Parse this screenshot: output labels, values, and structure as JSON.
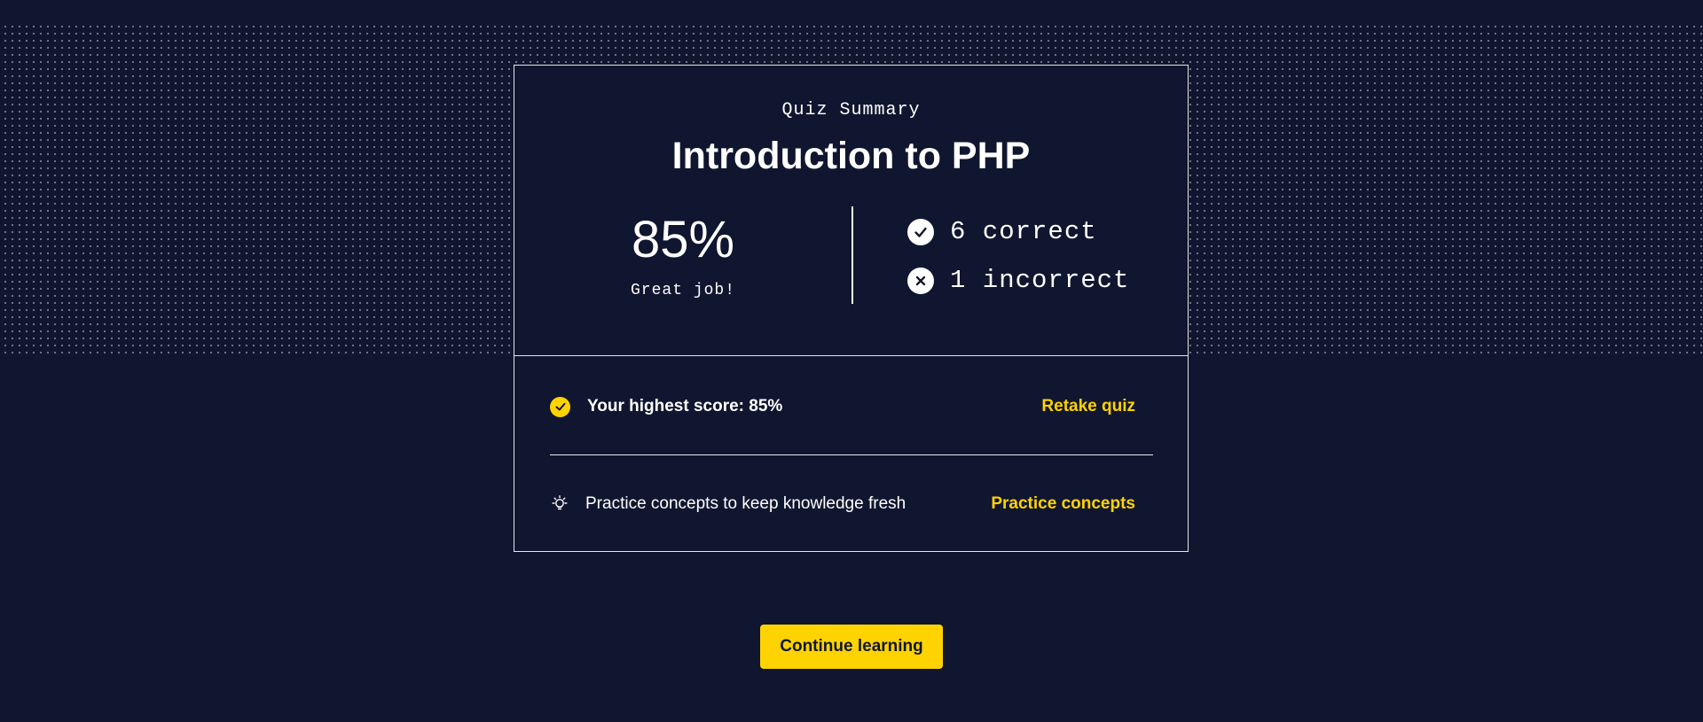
{
  "summary": {
    "eyebrow": "Quiz Summary",
    "title": "Introduction to PHP",
    "score": "85%",
    "score_message": "Great job!",
    "correct_label": "6 correct",
    "incorrect_label": "1 incorrect",
    "icons": {
      "correct": "check-circle-icon",
      "incorrect": "x-circle-icon"
    }
  },
  "highest": {
    "icon": "check-circle-icon",
    "text": "Your highest score: 85%",
    "link": "Retake quiz"
  },
  "practice": {
    "icon": "lightbulb-icon",
    "text": "Practice concepts to keep knowledge fresh",
    "link": "Practice concepts"
  },
  "cta": {
    "label": "Continue learning"
  },
  "colors": {
    "background": "#10162f",
    "accent": "#ffd300",
    "text": "#ffffff"
  }
}
